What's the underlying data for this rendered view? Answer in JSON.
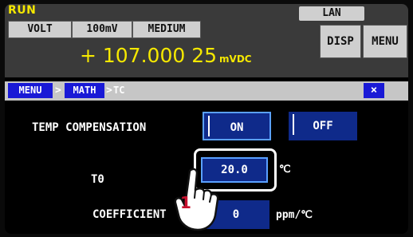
{
  "status": {
    "run": "RUN",
    "lan": "LAN"
  },
  "measurement": {
    "function": "VOLT",
    "range": "100mV",
    "speed": "MEDIUM",
    "value": "+ 107.000 25",
    "unit": "mVDC"
  },
  "buttons": {
    "disp": "DISP",
    "menu": "MENU"
  },
  "breadcrumb": {
    "items": [
      "MENU",
      "MATH"
    ],
    "separator": ">",
    "current": "TC",
    "close": "×"
  },
  "temp_compensation": {
    "label": "TEMP COMPENSATION",
    "on": "ON",
    "off": "OFF"
  },
  "t0": {
    "label": "T0",
    "value": "20.0",
    "unit": "℃"
  },
  "coefficient": {
    "label": "COEFFICIENT",
    "value": "0",
    "unit": "ppm/℃"
  },
  "callout": {
    "step": "1"
  },
  "colors": {
    "accent_yellow": "#f5e800",
    "button_blue": "#1919d6",
    "field_blue": "#0f2a8a",
    "focus": "#5aa0ff"
  }
}
